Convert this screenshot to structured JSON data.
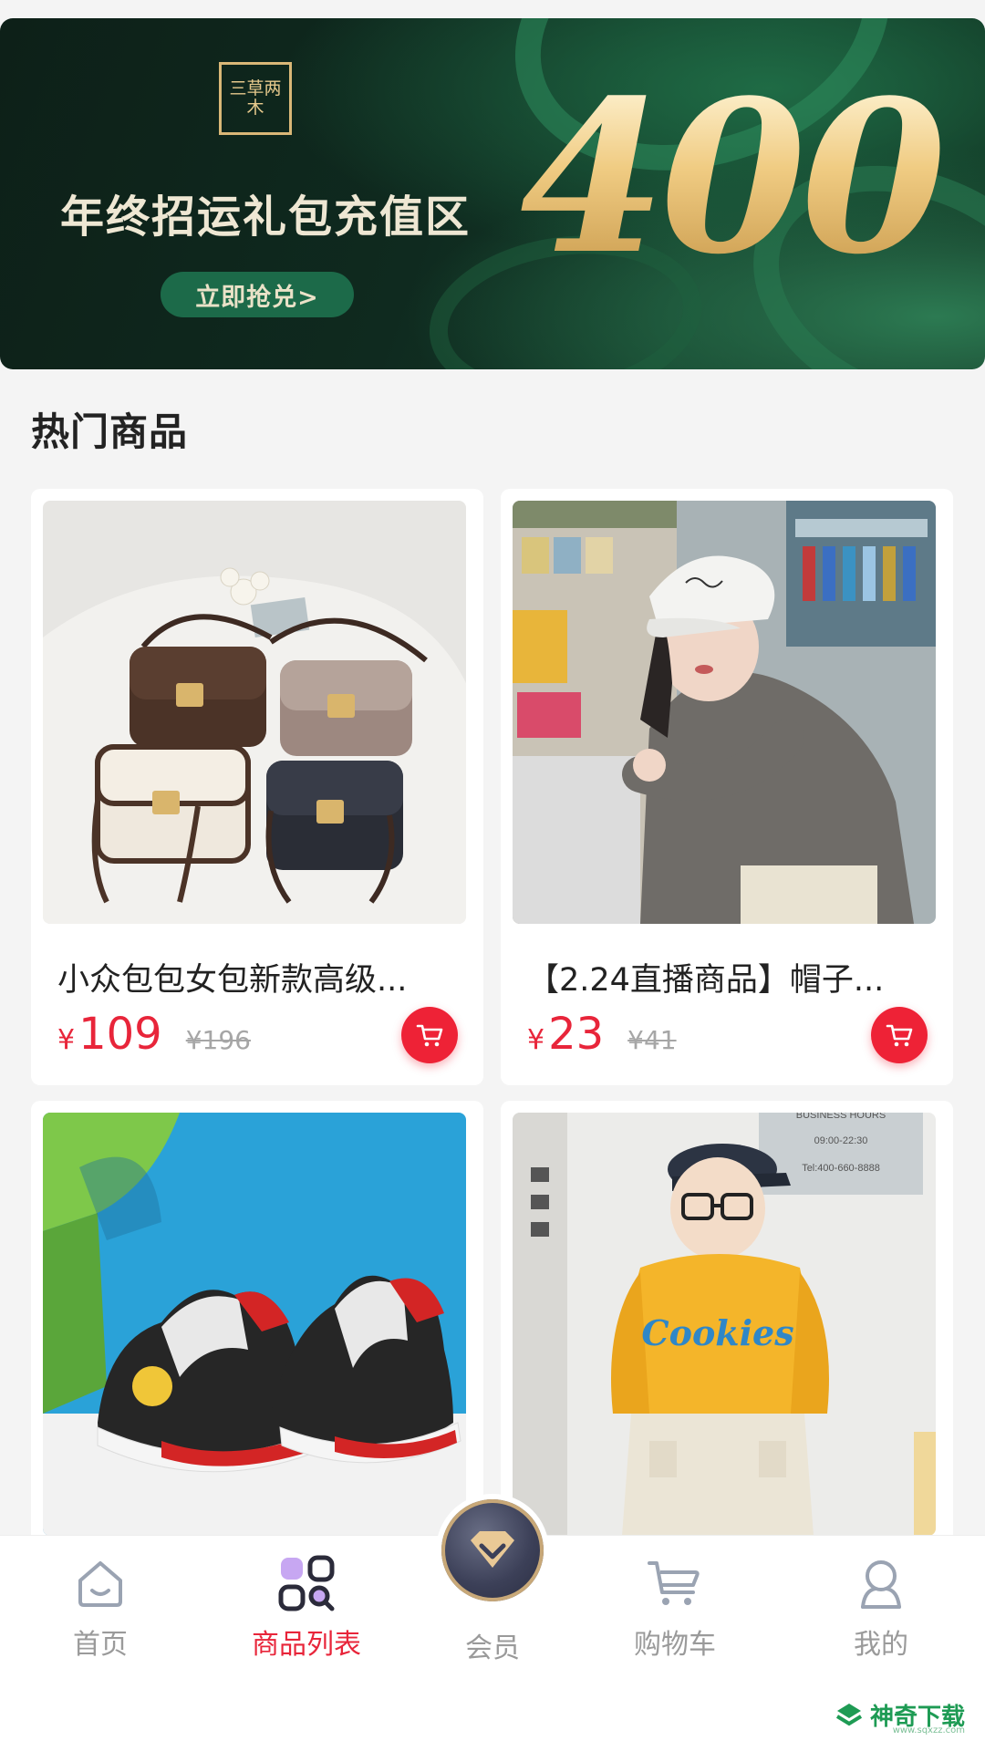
{
  "banner": {
    "brand_logo_text": "三草两木",
    "title": "年终招运礼包充值区",
    "cta_label": "立即抢兑>",
    "amount": "400"
  },
  "section": {
    "title": "热门商品"
  },
  "products": [
    {
      "name": "小众包包女包新款高级...",
      "currency": "¥",
      "price": "109",
      "original_price": "¥196",
      "image": "handbags"
    },
    {
      "name": "【2.24直播商品】帽子...",
      "currency": "¥",
      "price": "23",
      "original_price": "¥41",
      "image": "cap-model"
    },
    {
      "image": "kids-sneakers"
    },
    {
      "image": "kid-yellow-sweater",
      "shop_sign": {
        "line1": "BUSINESS HOURS",
        "line2": "09:00-22:30",
        "line3": "Tel:400-660-8888"
      },
      "sweater_text": "Cookies"
    }
  ],
  "tabbar": {
    "items": [
      {
        "label": "首页",
        "icon": "home-icon",
        "active": false
      },
      {
        "label": "商品列表",
        "icon": "product-list-icon",
        "active": true
      },
      {
        "label": "会员",
        "icon": "vip-diamond-icon",
        "active": false
      },
      {
        "label": "购物车",
        "icon": "cart-icon",
        "active": false
      },
      {
        "label": "我的",
        "icon": "profile-icon",
        "active": false
      }
    ]
  },
  "watermark": {
    "text": "神奇下载",
    "sub": "www.sqxzz.com"
  },
  "colors": {
    "accent_red": "#e8253a",
    "banner_green": "#0f2a1f",
    "gold": "#e6c98c"
  }
}
